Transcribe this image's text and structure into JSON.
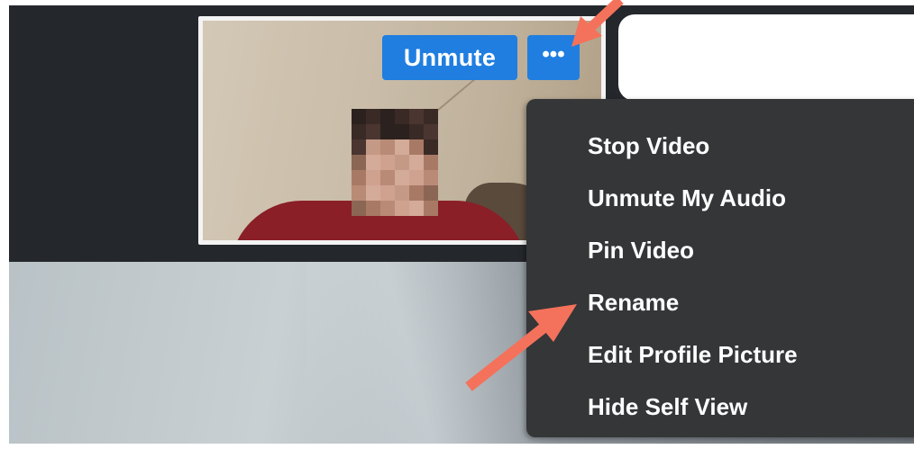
{
  "self_view": {
    "unmute_label": "Unmute",
    "more_label": "•••"
  },
  "context_menu": {
    "items": [
      {
        "label": "Stop Video"
      },
      {
        "label": "Unmute My Audio"
      },
      {
        "label": "Pin Video"
      },
      {
        "label": "Rename"
      },
      {
        "label": "Edit Profile Picture"
      },
      {
        "label": "Hide Self View"
      }
    ]
  },
  "annotations": {
    "arrow_color": "#f4725b"
  },
  "colors": {
    "button_blue": "#1f7ee0",
    "menu_bg": "#343638",
    "app_bg": "#24272b"
  },
  "icons": [
    "more-options-icon",
    "pixelated-face-icon"
  ]
}
